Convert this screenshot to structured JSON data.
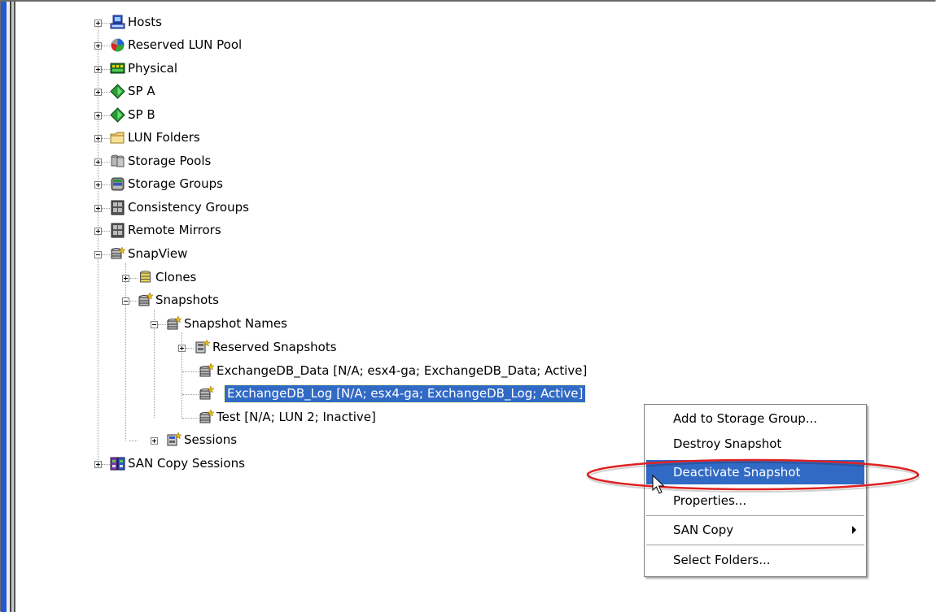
{
  "tree": {
    "items": [
      {
        "label": "Hosts",
        "icon": "hosts-icon"
      },
      {
        "label": "Reserved LUN Pool",
        "icon": "reserved-lun-pool-icon"
      },
      {
        "label": "Physical",
        "icon": "physical-icon"
      },
      {
        "label": "SP A",
        "icon": "sp-icon"
      },
      {
        "label": "SP B",
        "icon": "sp-icon"
      },
      {
        "label": "LUN Folders",
        "icon": "folder-icon"
      },
      {
        "label": "Storage Pools",
        "icon": "storage-pools-icon"
      },
      {
        "label": "Storage Groups",
        "icon": "storage-groups-icon"
      },
      {
        "label": "Consistency Groups",
        "icon": "consistency-groups-icon"
      },
      {
        "label": "Remote Mirrors",
        "icon": "remote-mirrors-icon"
      },
      {
        "label": "SnapView",
        "icon": "snapview-icon"
      },
      {
        "label": "Clones",
        "icon": "clones-icon"
      },
      {
        "label": "Snapshots",
        "icon": "snapshots-icon"
      },
      {
        "label": "Snapshot Names",
        "icon": "snapshot-names-icon"
      },
      {
        "label": "Reserved Snapshots",
        "icon": "reserved-snapshots-icon"
      },
      {
        "label": "ExchangeDB_Data [N/A; esx4-ga; ExchangeDB_Data; Active]",
        "icon": "snapshot-icon"
      },
      {
        "label": "ExchangeDB_Log [N/A; esx4-ga; ExchangeDB_Log; Active]",
        "icon": "snapshot-icon"
      },
      {
        "label": "Test [N/A; LUN 2; Inactive]",
        "icon": "snapshot-icon"
      },
      {
        "label": "Sessions",
        "icon": "sessions-icon"
      },
      {
        "label": "SAN Copy Sessions",
        "icon": "san-copy-sessions-icon"
      }
    ]
  },
  "context_menu": {
    "items": [
      {
        "label": "Add to Storage Group..."
      },
      {
        "label": "Destroy Snapshot"
      },
      {
        "label": "Deactivate Snapshot"
      },
      {
        "label": "Properties..."
      },
      {
        "label": "SAN Copy"
      },
      {
        "label": "Select Folders..."
      }
    ]
  },
  "colors": {
    "selection": "#316ac5",
    "annotation": "#e02020",
    "side_strip": "#2456d6"
  }
}
